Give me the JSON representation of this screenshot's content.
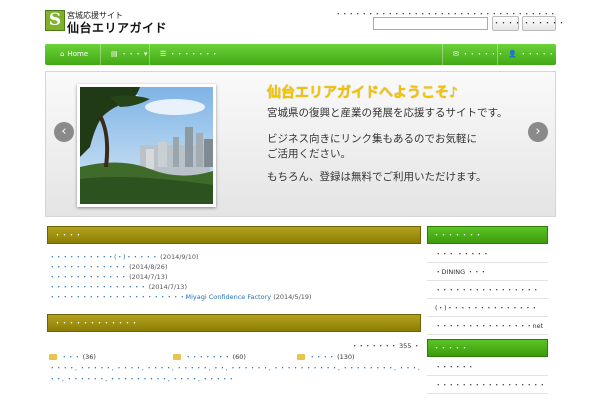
{
  "header": {
    "logo_letter": "S",
    "logo_sub": "宮城応援サイト",
    "logo_main": "仙台エリアガイド",
    "tagline": "・・・・・・・・・・・・・・・・・・・・・・・・・・・・・・・・・・",
    "search_placeholder": "",
    "search_button": "・・・・",
    "detail_button": "・・・・・・"
  },
  "nav": {
    "home": "Home",
    "category": "・・・",
    "category_arrow": "▾",
    "list": "・・・・・・・",
    "contact": "・・・・・・",
    "member": "・・・・・",
    "member_arrow": "▾"
  },
  "slider": {
    "title": "仙台エリアガイドへようこそ♪",
    "line1": "宮城県の復興と産業の発展を応援するサイトです。",
    "line2": "ビジネス向きにリンク集もあるのでお気軽に",
    "line3": "ご活用ください。",
    "line4": "もちろん、登録は無料でご利用いただけます。"
  },
  "news": {
    "heading": "・・・・",
    "items": [
      {
        "title": "・・・・・・・・・・(・)・・・・・",
        "date": "(2014/9/10)"
      },
      {
        "title": "・・・・・・・・・・・・",
        "date": "(2014/8/26)"
      },
      {
        "title": "・・・・・・・・・・・・",
        "date": "(2014/7/13)"
      },
      {
        "title": "・・・・・・・・・・・・・・・",
        "date": "(2014/7/13)"
      },
      {
        "title": "・・・・・・・・・・・・・・・・・・・・・Miyagi Confidence Factory",
        "date": "(2014/5/19)"
      }
    ]
  },
  "categories": {
    "heading": "・・・・・・・・・・・・",
    "total_label": "・・・・・・・ 355 ・",
    "items": [
      {
        "name": "・・・",
        "count": "(36)"
      },
      {
        "name": "・・・・・・・",
        "count": "(60)"
      },
      {
        "name": "・・・・",
        "count": "(130)"
      }
    ],
    "sub_links": "・・・・, ・・・・・, ・・・・, ・・・・, ・・・・・, ・・, ・・・・・・, ・・・・・・・・・・, ・・・・・・・・, ・・・, ・・, ・・・・・・, ・・・・・・・・・, ・・・・, ・・・・・"
  },
  "sidebar": {
    "heading1": "・・・・・・・",
    "items1": [
      "・・・ ・・・・・",
      "・DINING ・・・",
      "・・・・・・・・・・・・・・・・",
      "(・)・・・・・・・・・・・・・・",
      "・・・・・・・・・・・・・・・net"
    ],
    "heading2": "・・・・・",
    "items2": [
      "・・・・・・",
      "・・・・・・・・・・・・・・・・・・"
    ]
  },
  "colors": {
    "nav_green": "#4fb81f",
    "section_olive": "#9e8f0f",
    "welcome_yellow": "#f3c400",
    "link_blue": "#2a6fb8"
  }
}
